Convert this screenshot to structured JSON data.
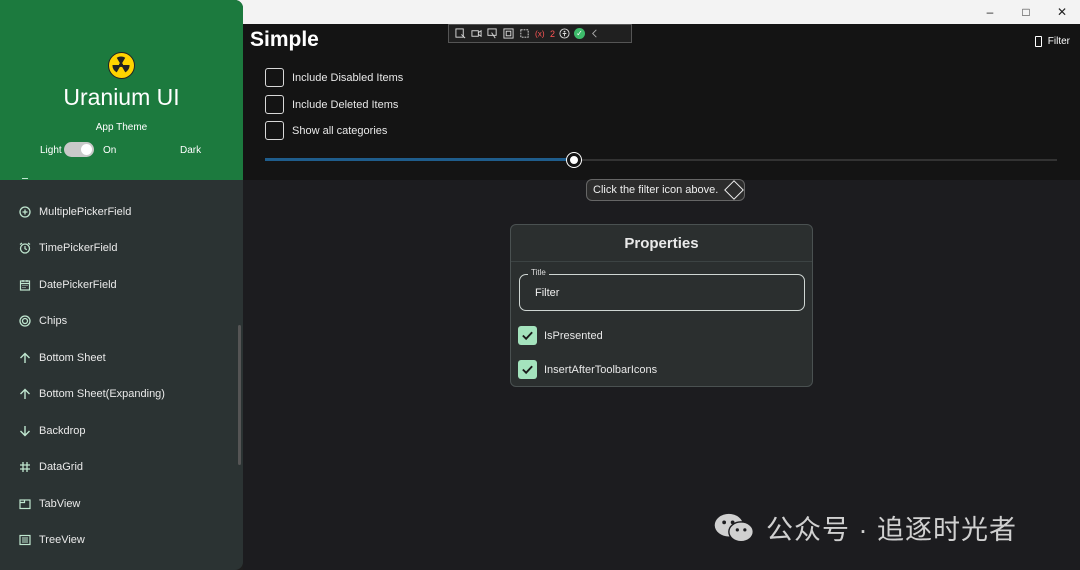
{
  "window": {
    "minimize": "–",
    "maximize": "□",
    "close": "✕"
  },
  "page": {
    "title": "Simple",
    "filter_label": "Filter"
  },
  "devtools": {
    "error_count": "2"
  },
  "options": [
    {
      "label": "Include Disabled Items",
      "checked": false
    },
    {
      "label": "Include Deleted Items",
      "checked": false
    },
    {
      "label": "Show all categories",
      "checked": false
    }
  ],
  "slider": {
    "value": 0.39
  },
  "tooltip": {
    "text": "Click the filter icon above."
  },
  "properties": {
    "title": "Properties",
    "field_label": "Title",
    "field_value": "Filter",
    "checks": [
      {
        "label": "IsPresented",
        "checked": true
      },
      {
        "label": "InsertAfterToolbarIcons",
        "checked": true
      }
    ]
  },
  "sidebar": {
    "brand": "Uranium UI",
    "theme_label": "App Theme",
    "light": "Light",
    "on": "On",
    "dark": "Dark",
    "items": [
      {
        "label": "MultiplePickerField",
        "icon": "plus-circle-icon"
      },
      {
        "label": "TimePickerField",
        "icon": "alarm-icon"
      },
      {
        "label": "DatePickerField",
        "icon": "calendar-icon"
      },
      {
        "label": "Chips",
        "icon": "target-icon"
      },
      {
        "label": "Bottom Sheet",
        "icon": "arrow-up-icon"
      },
      {
        "label": "Bottom Sheet(Expanding)",
        "icon": "arrow-up-icon"
      },
      {
        "label": "Backdrop",
        "icon": "arrow-down-icon"
      },
      {
        "label": "DataGrid",
        "icon": "hash-icon"
      },
      {
        "label": "TabView",
        "icon": "tab-icon"
      },
      {
        "label": "TreeView",
        "icon": "list-icon"
      }
    ]
  },
  "watermark": {
    "text": "公众号 · 追逐时光者"
  },
  "colors": {
    "accent_green": "#1c7a3e",
    "check_green": "#a4e3bd",
    "slider_blue": "#1f5d8c"
  }
}
